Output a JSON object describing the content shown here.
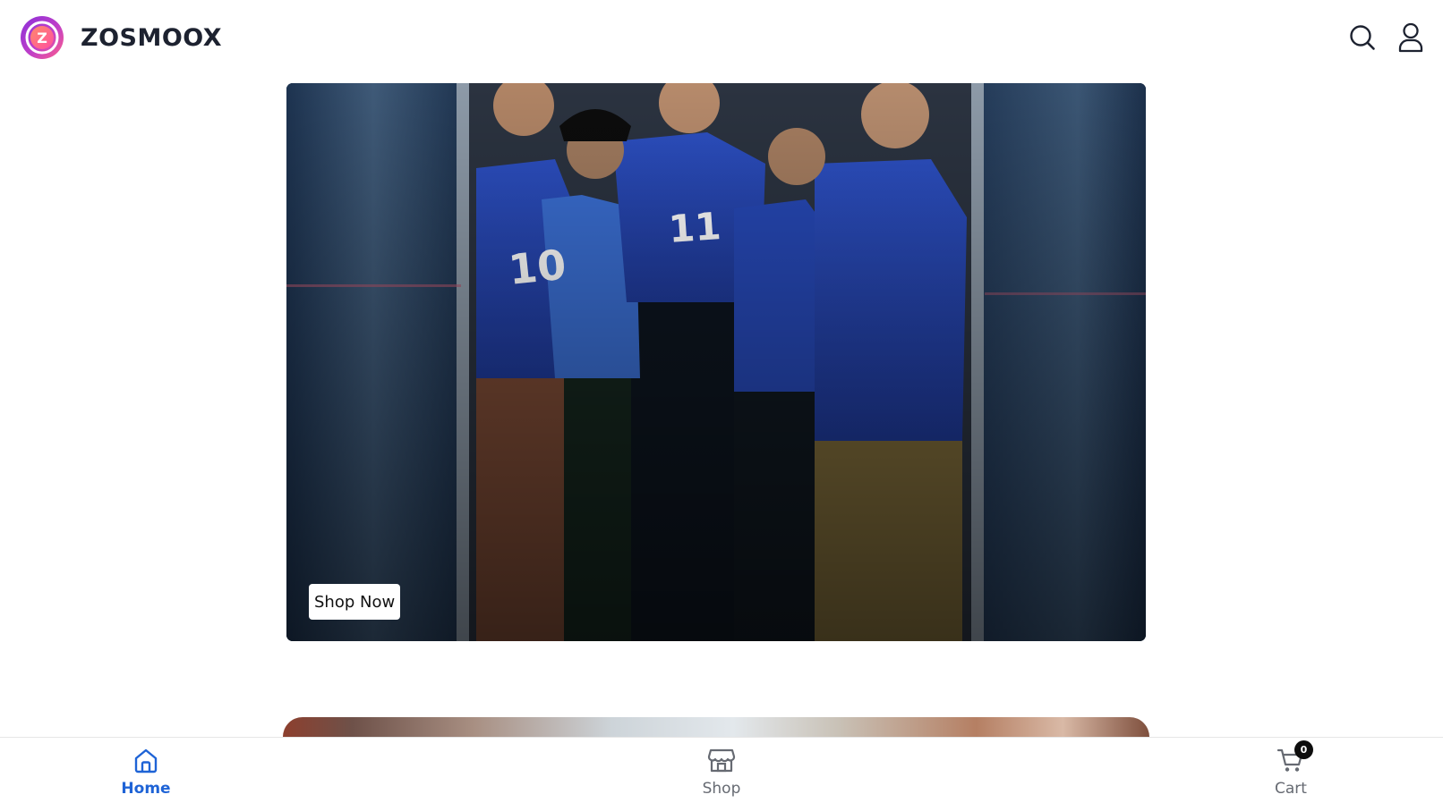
{
  "brand": {
    "name": "ZOSMOOX",
    "logo_icon": "brand-logo-icon",
    "logo_letter": "Z",
    "colors": {
      "gradient_start": "#b33bd6",
      "gradient_end": "#ff6b6b"
    }
  },
  "header": {
    "search_icon": "search-icon",
    "account_icon": "user-icon"
  },
  "hero": {
    "cta_label": "Shop Now",
    "jersey_numbers": [
      "10",
      "11"
    ]
  },
  "bottom_nav": {
    "items": [
      {
        "label": "Home",
        "icon": "home-icon",
        "active": true
      },
      {
        "label": "Shop",
        "icon": "store-icon",
        "active": false
      },
      {
        "label": "Cart",
        "icon": "cart-icon",
        "active": false
      }
    ],
    "cart_count": "0",
    "active_color": "#1e63d6",
    "inactive_color": "#666a72"
  }
}
